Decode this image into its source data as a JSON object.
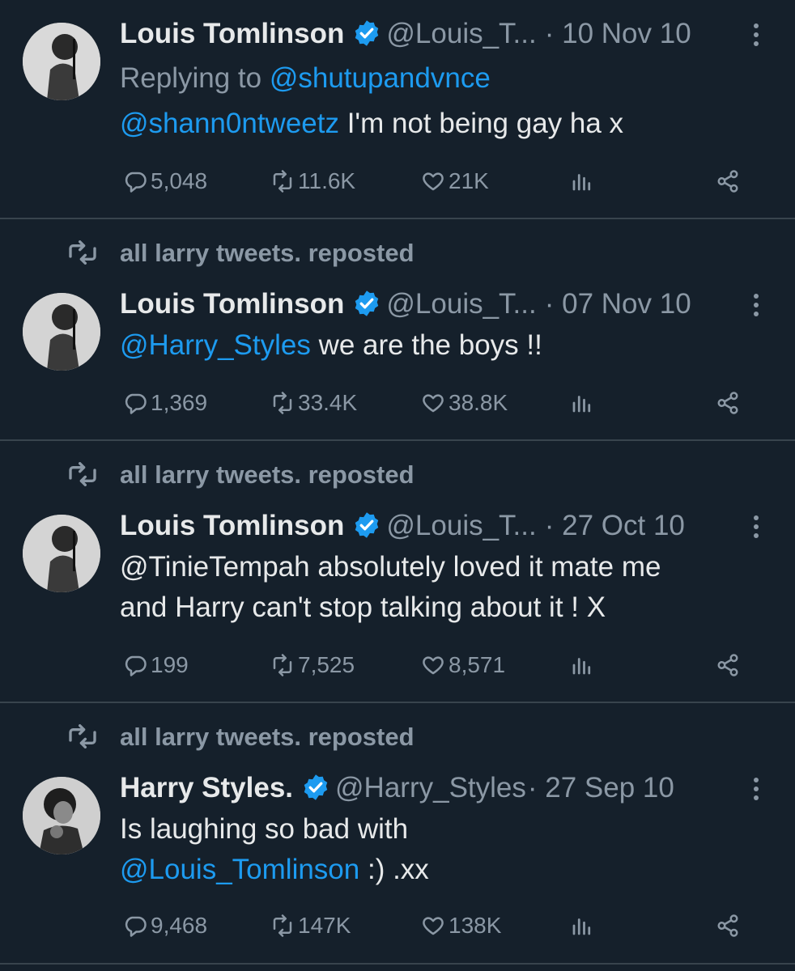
{
  "colors": {
    "background": "#15202b",
    "text": "#e7e9ea",
    "muted": "#8b98a5",
    "link": "#1d9bf0",
    "divider": "#38444d",
    "verified": "#1d9bf0"
  },
  "tweets": [
    {
      "author": "Louis Tomlinson",
      "handle": "@Louis_T...",
      "date": "· 10 Nov 10",
      "replying_label": "Replying to",
      "replying_to": "@shutupandvnce",
      "mention": "@shann0ntweetz",
      "text": " I'm not being gay ha x",
      "replies": "5,048",
      "reposts": "11.6K",
      "likes": "21K"
    },
    {
      "repost_label": "all larry tweets. reposted",
      "author": "Louis Tomlinson",
      "handle": "@Louis_T...",
      "date": "· 07 Nov 10",
      "mention": "@Harry_Styles",
      "text": " we are the boys !!",
      "replies": "1,369",
      "reposts": "33.4K",
      "likes": "38.8K"
    },
    {
      "repost_label": "all larry tweets. reposted",
      "author": "Louis Tomlinson",
      "handle": "@Louis_T...",
      "date": "· 27 Oct 10",
      "text_line1": "@TinieTempah absolutely loved it mate me",
      "text_line2": "and Harry can't stop talking about it ! X",
      "replies": "199",
      "reposts": "7,525",
      "likes": "8,571"
    },
    {
      "repost_label": "all larry tweets. reposted",
      "author": "Harry Styles.",
      "handle": "@Harry_Styles",
      "date": "· 27 Sep 10",
      "text_line1": "Is laughing so bad with",
      "mention": "@Louis_Tomlinson",
      "text_after": " :) .xx",
      "replies": "9,468",
      "reposts": "147K",
      "likes": "138K"
    }
  ],
  "icons": [
    "reply-icon",
    "repost-icon",
    "like-icon",
    "views-icon",
    "share-icon",
    "verified-icon",
    "more-icon"
  ]
}
